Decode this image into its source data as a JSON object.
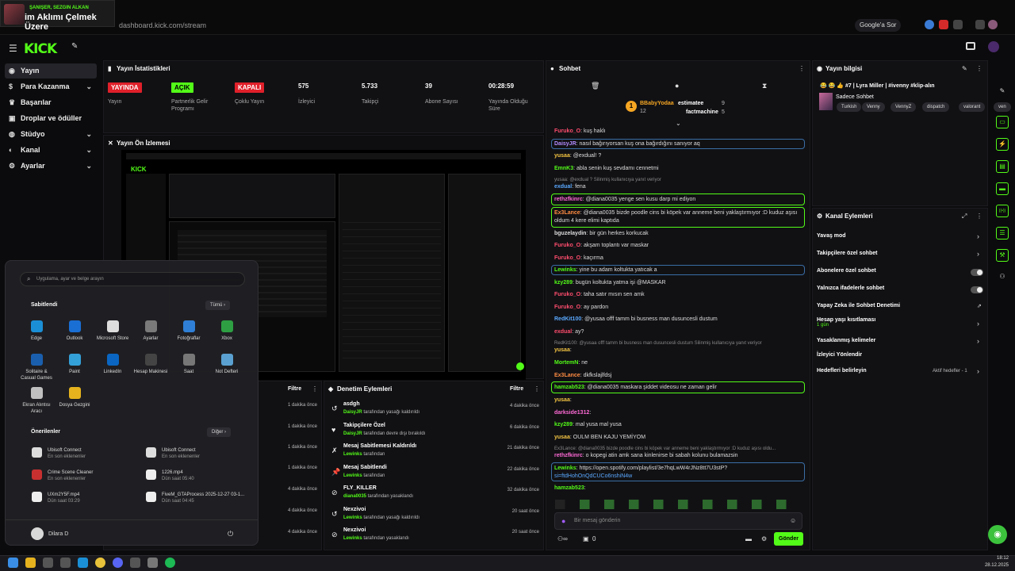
{
  "browser": {
    "tab_title": "im Aklımı Çelmek Üzere",
    "tab_subtitle": "ŞANIŞER, SEZGIN ALKAN",
    "url": "dashboard.kick.com/stream",
    "google_chip": "Google'a Sor"
  },
  "brand": {
    "logo": "KICK",
    "accent": "#53fc18"
  },
  "sidebar": {
    "items": [
      {
        "label": "Yayın",
        "icon": "broadcast-icon",
        "active": true
      },
      {
        "label": "Para Kazanma",
        "icon": "money-icon",
        "chevron": true
      },
      {
        "label": "Başarılar",
        "icon": "trophy-icon"
      },
      {
        "label": "Droplar ve ödüller",
        "icon": "gift-icon"
      },
      {
        "label": "Stüdyo",
        "icon": "studio-icon",
        "chevron": true
      },
      {
        "label": "Kanal",
        "icon": "user-icon",
        "chevron": true
      },
      {
        "label": "Ayarlar",
        "icon": "gear-icon",
        "chevron": true
      }
    ]
  },
  "stats": {
    "title": "Yayın İstatistikleri",
    "items": [
      {
        "badge": "YAYINDA",
        "badge_color": "#e0202a",
        "label": "Yayın"
      },
      {
        "badge": "AÇIK",
        "badge_color": "#53fc18",
        "label": "Partnerlik Gelir Programı"
      },
      {
        "badge": "KAPALI",
        "badge_color": "#e0202a",
        "label": "Çoklu Yayın"
      },
      {
        "value": "575",
        "label": "İzleyici"
      },
      {
        "value": "5.733",
        "label": "Takipçi"
      },
      {
        "value": "39",
        "label": "Abone Sayısı"
      },
      {
        "value": "00:28:59",
        "label": "Yayında Olduğu Süre"
      }
    ]
  },
  "preview": {
    "title": "Yayın Ön İzlemesi"
  },
  "startmenu": {
    "search_placeholder": "Uygulama, ayar ve belge arayın",
    "pinned_title": "Sabitlendi",
    "all_label": "Tümü",
    "pinned": [
      "Edge",
      "Outlook",
      "Microsoft Store",
      "Ayarlar",
      "Fotoğraflar",
      "Xbox",
      "Solitaire & Casual Games",
      "Paint",
      "LinkedIn",
      "Hesap Makinesi",
      "Saat",
      "Not Defteri",
      "Ekran Alıntısı Aracı",
      "Dosya Gezgini"
    ],
    "recommended_title": "Önerilenler",
    "more_label": "Diğer",
    "recommended": [
      {
        "name": "Ubisoft Connect",
        "sub": "En son eklenenler"
      },
      {
        "name": "Ubisoft Connect",
        "sub": "En son eklenenler"
      },
      {
        "name": "Crime Scene Cleaner",
        "sub": "En son eklenenler"
      },
      {
        "name": "1226.mp4",
        "sub": "Dün saat 05:40"
      },
      {
        "name": "UXm2Y5F.mp4",
        "sub": "Dün saat 03:29"
      },
      {
        "name": "FiveM_GTAProcess 2025-12-27 03-1...",
        "sub": "Dün saat 04:45"
      }
    ],
    "user": "Dilara D"
  },
  "left_list": {
    "filter": "Filtre",
    "times": [
      "1 dakika önce",
      "1 dakika önce",
      "1 dakika önce",
      "1 dakika önce",
      "4 dakika önce",
      "4 dakika önce",
      "4 dakika önce"
    ]
  },
  "moderation": {
    "title": "Denetim Eylemleri",
    "filter": "Filtre",
    "items": [
      {
        "title": "asdgh",
        "user": "DaisyJR",
        "action": "tarafından yasağı kaldırıldı",
        "time": "4 dakika önce"
      },
      {
        "title": "Takipçilere Özel",
        "user": "DaisyJR",
        "action": "tarafından devre dışı bırakıldı",
        "time": "6 dakika önce"
      },
      {
        "title": "Mesaj Sabitlemesi Kaldırıldı",
        "user": "Lewinks",
        "action": "tarafından",
        "time": "21 dakika önce"
      },
      {
        "title": "Mesaj Sabitlendi",
        "user": "Lewinks",
        "action": "tarafından",
        "time": "22 dakika önce"
      },
      {
        "title": "FLY_KILLER",
        "user": "diana0035",
        "action": "tarafından yasaklandı",
        "time": "32 dakika önce"
      },
      {
        "title": "Nexzivoi",
        "user": "Lewinks",
        "action": "tarafından yasağı kaldırıldı",
        "time": "20 saat önce"
      },
      {
        "title": "Nexzivoi",
        "user": "Lewinks",
        "action": "tarafından yasaklandı",
        "time": "20 saat önce"
      }
    ]
  },
  "chat": {
    "title": "Sohbet",
    "top": [
      {
        "name": "BBabyYodaa",
        "count": "12"
      },
      {
        "name": "estimatee",
        "count": "9"
      },
      {
        "name": "factmachine",
        "count": "5"
      }
    ],
    "messages": [
      {
        "user": "Furuko_O",
        "color": "#ff4d6d",
        "text": ": kuş haklı"
      },
      {
        "user": "DaisyJR",
        "color": "#b48cff",
        "text": ": nasıl bağırıyorsan kuş ona bağırdığını sanıyor aq"
      },
      {
        "user": "yusaa",
        "color": "#f5c542",
        "text": ": @exdual! ?"
      },
      {
        "user": "EmnK3",
        "color": "#53fc18",
        "text": ": abla senin kuş sevdamı cennetmi"
      },
      {
        "user": "",
        "color": "#888",
        "text": "yusaa: @exdual ? Silinmiş kullanıcıya yanıt veriyor"
      },
      {
        "user": "exdual",
        "color": "#5aa9ff",
        "text": ": fena"
      },
      {
        "user": "rethzfkinrc",
        "color": "#ff6ad5",
        "text": ": @diana0035 yenge sen kusu darp mi ediyon"
      },
      {
        "user": "Ex3Lance",
        "color": "#ff8c42",
        "text": ": @diana0035 bizde poodle cins bi köpek var anneme beni yaklaştırmıyor :D kuduz aşısı"
      },
      {
        "user": "",
        "color": "#ddd",
        "text": "oldum 4 kere elimi kaptıda"
      },
      {
        "user": "bguzelaydin",
        "color": "#ddd",
        "text": ": bir gün herkes korkucak"
      },
      {
        "user": "Furuko_O",
        "color": "#ff4d6d",
        "text": ": akşam toplantı var maskar"
      },
      {
        "user": "Furuko_O",
        "color": "#ff4d6d",
        "text": ": kaçırma"
      },
      {
        "user": "Lewinks",
        "color": "#53fc18",
        "text": ": yine bu adam koltukta yatıcak a"
      },
      {
        "user": "kzy289",
        "color": "#53fc18",
        "text": ": bugün koltukta yatma işi @MASKAR"
      },
      {
        "user": "Furuko_O",
        "color": "#ff4d6d",
        "text": ": taha satır mısın sen amk"
      },
      {
        "user": "Furuko_O",
        "color": "#ff4d6d",
        "text": ": ay pardon"
      },
      {
        "user": "RedKit100",
        "color": "#5aa9ff",
        "text": ": @yusaa offf tamm bi busness man dusuncesli dustum"
      },
      {
        "user": "exdual",
        "color": "#ff4d6d",
        "text": ": ay?"
      },
      {
        "user": "",
        "color": "#888",
        "text": "RedKit100: @yusaa offf tamm bi busness man dusuncesli dustum Silinmiş kullanıcıya yanıt veriyor"
      },
      {
        "user": "yusaa",
        "color": "#f5c542",
        "text": ":"
      },
      {
        "user": "MortemN",
        "color": "#53fc18",
        "text": ": ne"
      },
      {
        "user": "Ex3Lance",
        "color": "#ff8c42",
        "text": ": dkfkslajlfdsj"
      },
      {
        "user": "hamzab523",
        "color": "#53fc18",
        "text": ": @diana0035 maskara şiddet videosu ne zaman gelir"
      },
      {
        "user": "yusaa",
        "color": "#f5c542",
        "text": ":"
      },
      {
        "user": "darkside1312",
        "color": "#ff6ad5",
        "text": ":"
      },
      {
        "user": "kzy289",
        "color": "#53fc18",
        "text": ": mal yusa mal yusa"
      },
      {
        "user": "yusaa",
        "color": "#f5c542",
        "text": ": OULM BEN KAJU YEMİYOM"
      },
      {
        "user": "",
        "color": "#888",
        "text": "Ex3Lance: @diana0035 bizde poodle cins bi köpek var anneme beni yaklaştırmıyor :D kuduz aşısı oldu..."
      },
      {
        "user": "rethzfkinrc",
        "color": "#ff6ad5",
        "text": ": o kopegi atin amk sana kinlenirse bi sabah kolunu bulamazsin"
      },
      {
        "user": "Lewinks",
        "color": "#53fc18",
        "text": ": https://open.spotify.com/playlist/3e7hqLwW4rJNz8tt7U3stP?"
      },
      {
        "user": "",
        "color": "#5aa9ff",
        "text": "si=ftdHohOnQdCUCo6nshiN4w"
      },
      {
        "user": "hamzab523",
        "color": "#53fc18",
        "text": ":"
      }
    ],
    "input_placeholder": "Bir mesaj gönderin",
    "points": "0",
    "send_label": "Gönder"
  },
  "stream_info": {
    "title": "Yayın bilgisi",
    "stream_title": "😂 😂 👍 #7 | Lyra Miller | #ivenny #klip-alın",
    "category": "Sadece Sohbet",
    "tags": [
      "Turkish",
      "Venny",
      "VennyZ",
      "dispatch",
      "valorant",
      "ven"
    ]
  },
  "channel_actions": {
    "title": "Kanal Eylemleri",
    "items": [
      {
        "label": "Yavaş mod",
        "type": "arrow"
      },
      {
        "label": "Takipçilere özel sohbet",
        "type": "arrow"
      },
      {
        "label": "Abonelere özel sohbet",
        "type": "toggle"
      },
      {
        "label": "Yalnızca ifadelerle sohbet",
        "type": "toggle"
      },
      {
        "label": "Yapay Zeka ile Sohbet Denetimi",
        "type": "external"
      },
      {
        "label": "Hesap yaşı kısıtlaması",
        "sub": "1 gün",
        "type": "arrow"
      },
      {
        "label": "Yasaklanmış kelimeler",
        "type": "arrow"
      },
      {
        "label": "İzleyici Yönlendir",
        "type": "none"
      },
      {
        "label": "Hedefleri belirleyin",
        "status": "Aktif hedefler - 1",
        "type": "arrow"
      }
    ]
  },
  "taskbar": {
    "time": "18:12",
    "date": "28.12.2025"
  }
}
